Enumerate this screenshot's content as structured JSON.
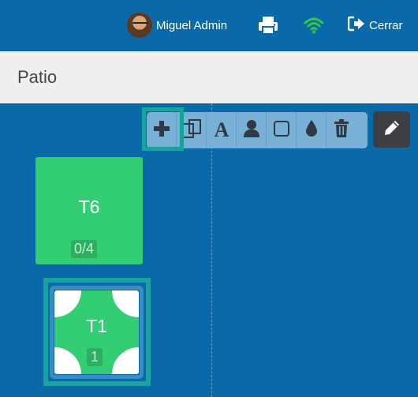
{
  "header": {
    "user_name": "Miguel Admin",
    "logout_label": "Cerrar",
    "icons": {
      "printer": "printer-icon",
      "wifi": "wifi-icon",
      "logout": "logout-icon"
    },
    "colors": {
      "background": "#0a69a8",
      "wifi": "#35c44a"
    }
  },
  "page": {
    "title": "Patio"
  },
  "toolbar": {
    "tools": [
      {
        "name": "add",
        "icon": "plus-icon"
      },
      {
        "name": "duplicate",
        "icon": "copy-icon"
      },
      {
        "name": "text",
        "icon": "font-icon"
      },
      {
        "name": "user",
        "icon": "user-icon"
      },
      {
        "name": "shape",
        "icon": "square-icon"
      },
      {
        "name": "color",
        "icon": "droplet-icon"
      },
      {
        "name": "delete",
        "icon": "trash-icon"
      }
    ],
    "edit_icon": "pencil-icon",
    "accent": "#18a2a0"
  },
  "tables": [
    {
      "label": "T6",
      "capacity": "0/4",
      "color": "#33ce74"
    },
    {
      "label": "T1",
      "capacity": "1",
      "color": "#33ce74"
    }
  ]
}
